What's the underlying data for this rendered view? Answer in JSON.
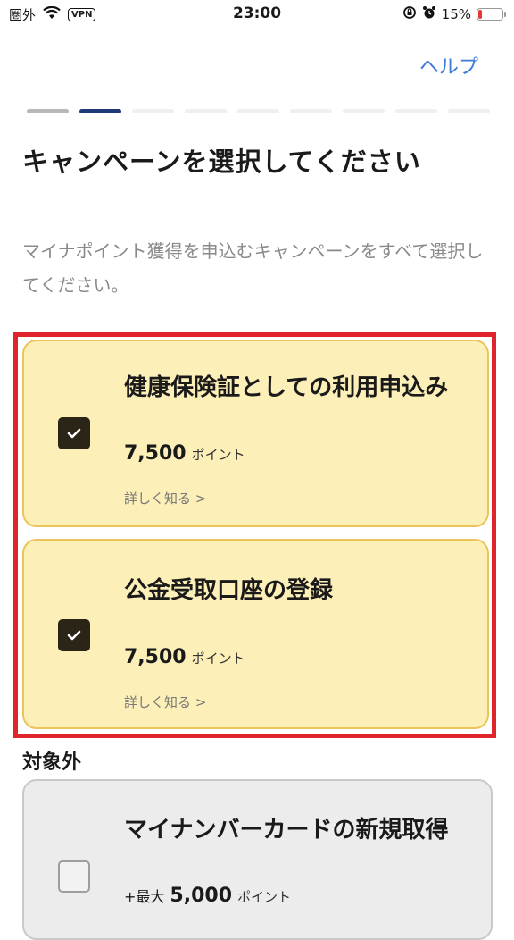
{
  "status_bar": {
    "carrier": "圏外",
    "vpn": "VPN",
    "time": "23:00",
    "battery_percent_label": "15%",
    "battery_level": 0.15,
    "battery_color": "#e53935"
  },
  "header": {
    "help_label": "ヘルプ"
  },
  "progress": {
    "total_steps": 9,
    "current_step": 2
  },
  "page_title": "キャンペーンを選択してください",
  "description": "マイナポイント獲得を申込むキャンペーンをすべて選択してください。",
  "campaigns": [
    {
      "title": "健康保険証としての利用申込み",
      "points_value": "7,500",
      "points_unit": "ポイント",
      "learn_more": "詳しく知る >",
      "checked": true
    },
    {
      "title": "公金受取口座の登録",
      "points_value": "7,500",
      "points_unit": "ポイント",
      "learn_more": "詳しく知る >",
      "checked": true
    }
  ],
  "excluded_section": {
    "heading": "対象外",
    "items": [
      {
        "title": "マイナンバーカードの新規取得",
        "points_prefix": "+最大",
        "points_value": "5,000",
        "points_unit": "ポイント",
        "checked": false
      }
    ]
  },
  "colors": {
    "accent_link": "#3d7bd8",
    "progress_current": "#1f3a78",
    "selected_card_bg": "#fcefb7",
    "highlight_border": "#e0242b"
  }
}
